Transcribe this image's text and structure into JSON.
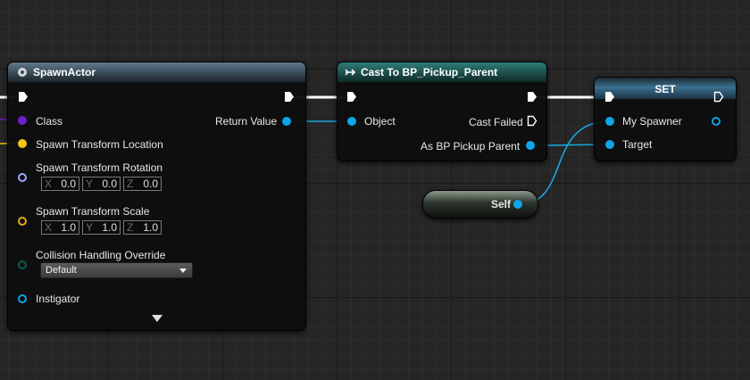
{
  "spawn_actor": {
    "title": "SpawnActor",
    "return_value_label": "Return Value",
    "class_label": "Class",
    "location_label": "Spawn Transform Location",
    "rotation": {
      "label": "Spawn Transform Rotation",
      "x_axis": "X",
      "x": "0.0",
      "y_axis": "Y",
      "y": "0.0",
      "z_axis": "Z",
      "z": "0.0"
    },
    "scale": {
      "label": "Spawn Transform Scale",
      "x_axis": "X",
      "x": "1.0",
      "y_axis": "Y",
      "y": "1.0",
      "z_axis": "Z",
      "z": "1.0"
    },
    "collision": {
      "label": "Collision Handling Override",
      "selected": "Default"
    },
    "instigator_label": "Instigator"
  },
  "cast_node": {
    "title": "Cast To BP_Pickup_Parent",
    "object_label": "Object",
    "cast_failed_label": "Cast Failed",
    "as_label": "As BP Pickup Parent"
  },
  "set_node": {
    "title": "SET",
    "my_spawner_label": "My Spawner",
    "target_label": "Target"
  },
  "self_node": {
    "label": "Self"
  },
  "colors": {
    "exec": "#ffffff",
    "object_pin": "#0ea5e9",
    "class_pin": "#6b1fc9",
    "vector_pin": "#f5c518",
    "rotator_pin": "#9aa8ff",
    "scale_pin": "#e5a91a",
    "enum_pin": "#0d5a53",
    "wire_object": "#18a6e0"
  },
  "icons": {
    "spawn_header": "spawn-gear-icon",
    "cast_header": "cast-arrow-icon",
    "expand": "expand-arrow-icon"
  }
}
